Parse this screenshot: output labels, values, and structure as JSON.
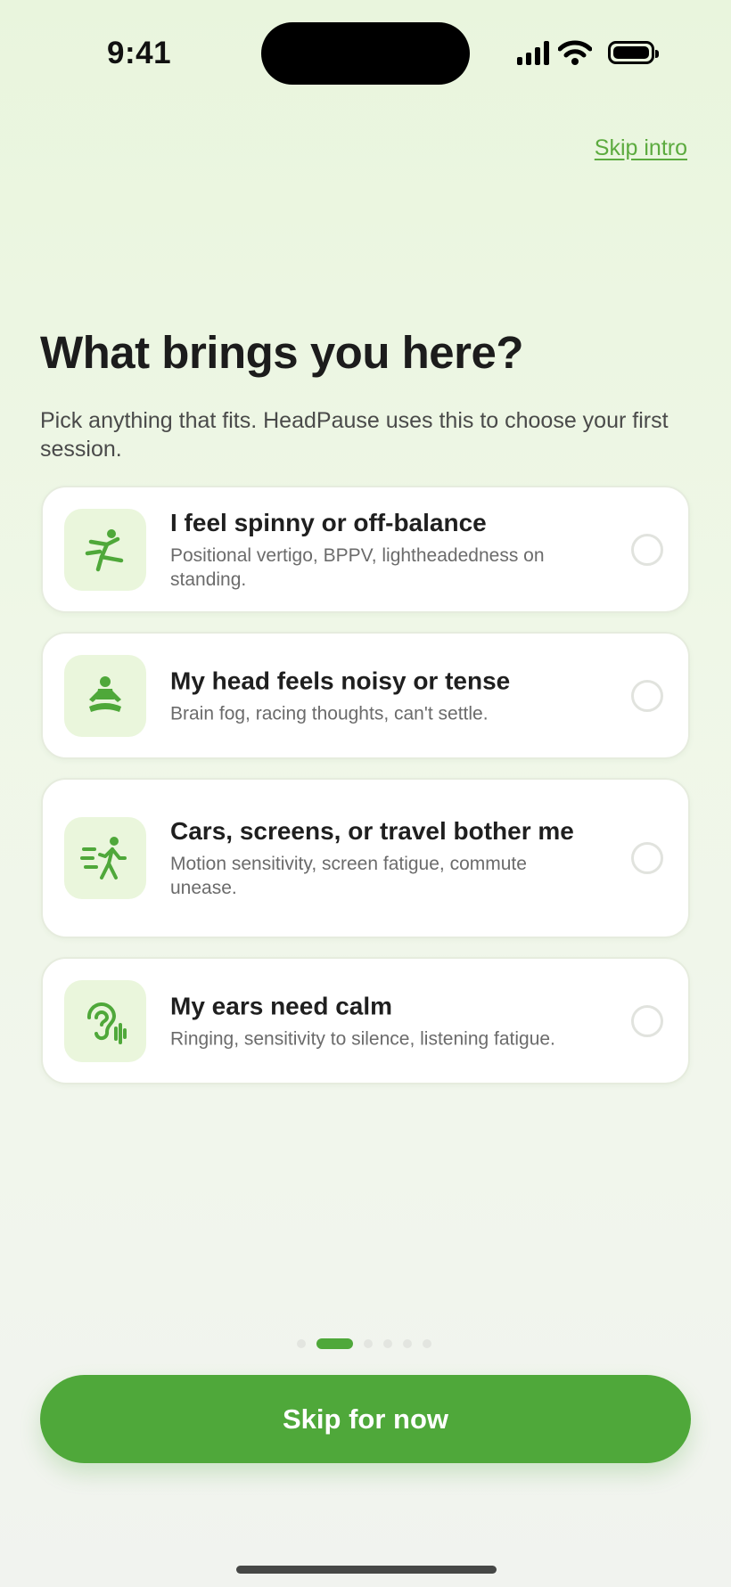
{
  "status_bar": {
    "time": "9:41"
  },
  "header": {
    "skip_intro_label": "Skip intro"
  },
  "intro": {
    "title": "What brings you here?",
    "subtitle": "Pick anything that fits. HeadPause uses this to choose your first session."
  },
  "options": [
    {
      "title": "I feel spinny or off-balance",
      "description": "Positional vertigo, BPPV, lightheadedness on standing.",
      "icon": "off-balance-figure-icon",
      "selected": false
    },
    {
      "title": "My head feels noisy or tense",
      "description": "Brain fog, racing thoughts, can't settle.",
      "icon": "meditation-figure-icon",
      "selected": false
    },
    {
      "title": "Cars, screens, or travel bother me",
      "description": "Motion sensitivity, screen fatigue, commute unease.",
      "icon": "walking-figure-motion-icon",
      "selected": false
    },
    {
      "title": "My ears need calm",
      "description": "Ringing, sensitivity to silence, listening fatigue.",
      "icon": "ear-sound-icon",
      "selected": false
    }
  ],
  "pagination": {
    "current": 2,
    "total": 6
  },
  "footer": {
    "cta_label": "Skip for now"
  },
  "colors": {
    "accent": "#4fa83a",
    "icon_bg": "#eaf6dc",
    "link": "#5cab3f"
  }
}
